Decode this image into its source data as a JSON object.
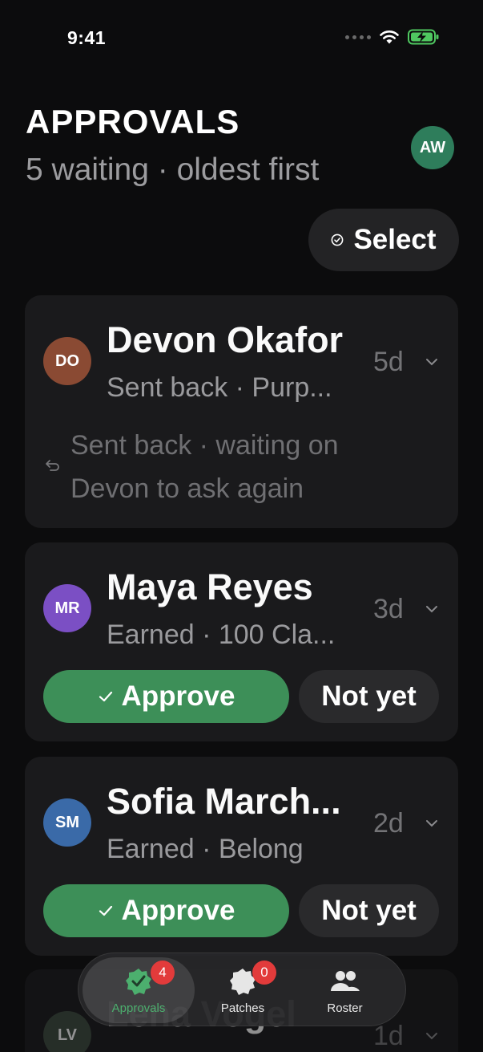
{
  "status": {
    "time": "9:41"
  },
  "header": {
    "title": "APPROVALS",
    "subtitle": "5 waiting · oldest first",
    "avatar_initials": "AW",
    "select_label": "Select"
  },
  "cards": [
    {
      "initials": "DO",
      "name": "Devon Okafor",
      "meta": "Sent back · Purp...",
      "age": "5d",
      "note_line1": "Sent back · waiting on",
      "note_line2": "Devon to ask again",
      "color": "#8a4a33"
    },
    {
      "initials": "MR",
      "name": "Maya Reyes",
      "meta": "Earned · 100 Cla...",
      "age": "3d",
      "approve_label": "Approve",
      "notyet_label": "Not yet",
      "color": "#7b4fc4"
    },
    {
      "initials": "SM",
      "name": "Sofia March...",
      "meta": "Earned · Belong",
      "age": "2d",
      "approve_label": "Approve",
      "notyet_label": "Not yet",
      "color": "#3a6aa8"
    },
    {
      "initials": "LV",
      "name": "Lena Vogel",
      "age": "1d",
      "color": "#3d4a3f"
    }
  ],
  "tabs": [
    {
      "label": "Approvals",
      "badge": "4",
      "icon": "verified-badge-icon"
    },
    {
      "label": "Patches",
      "badge": "0",
      "icon": "patch-icon"
    },
    {
      "label": "Roster",
      "icon": "people-icon"
    }
  ],
  "colors": {
    "accent_green": "#3d8f58",
    "badge_red": "#e23b3b",
    "background": "#0c0c0d",
    "card": "#1a1a1c"
  }
}
